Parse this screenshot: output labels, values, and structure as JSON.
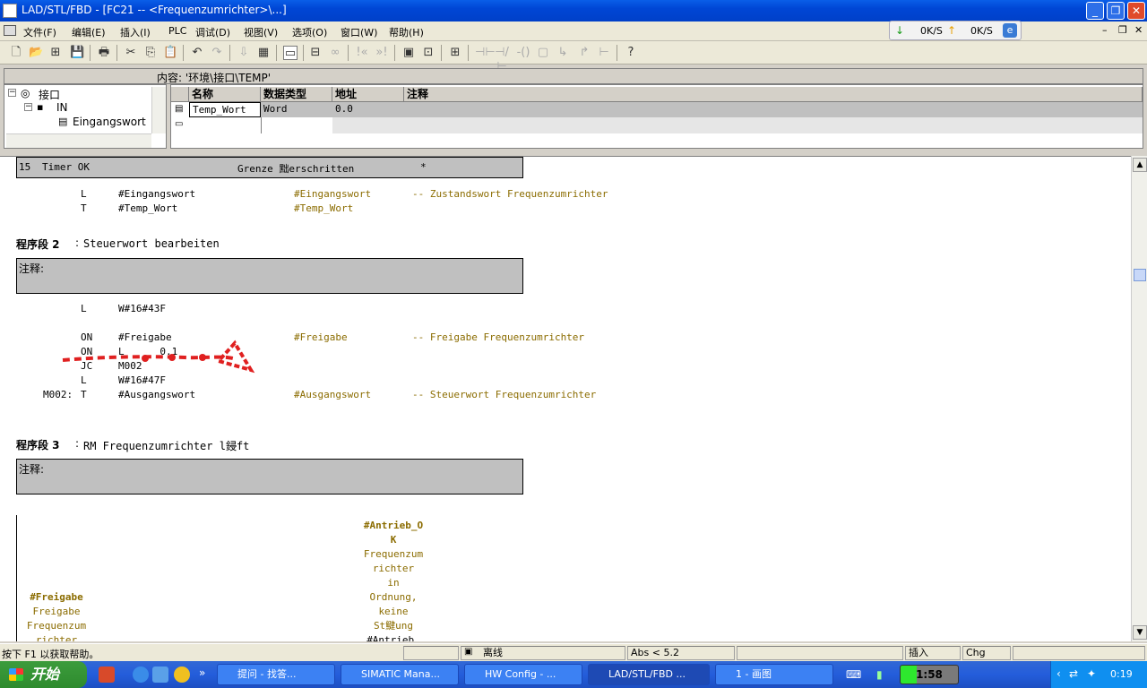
{
  "window": {
    "title": "LAD/STL/FBD - [FC21 -- <Frequenzumrichter>\\...]"
  },
  "menu": [
    "文件(F)",
    "编辑(E)",
    "插入(I)",
    "PLC",
    "调试(D)",
    "视图(V)",
    "选项(O)",
    "窗口(W)",
    "帮助(H)"
  ],
  "netspeed": {
    "down": "0K/S",
    "up": "0K/S"
  },
  "content_path": "内容: '环境\\接口\\TEMP'",
  "tree": {
    "root": "接口",
    "in": "IN",
    "child": "Eingangswort"
  },
  "vartable": {
    "headers": [
      "名称",
      "数据类型",
      "地址",
      "注释"
    ],
    "rows": [
      {
        "name": "Temp_Wort",
        "type": "Word",
        "addr": "0.0",
        "comment": ""
      }
    ]
  },
  "editor": {
    "top_box": {
      "num": "15",
      "label": "Timer OK",
      "mid": "Grenze 黜erschritten",
      "star": "*"
    },
    "seg1_lines": [
      {
        "op": "L",
        "arg": "#Eingangswort",
        "sym": "#Eingangswort",
        "cmt": "-- Zustandswort Frequenzumrichter"
      },
      {
        "op": "T",
        "arg": "#Temp_Wort",
        "sym": "#Temp_Wort",
        "cmt": ""
      }
    ],
    "seg2": {
      "title": "程序段 2",
      "desc": "Steuerwort bearbeiten",
      "comment_label": "注释:"
    },
    "seg2_lines": [
      {
        "label": "",
        "op": "L",
        "arg": "W#16#43F",
        "sym": "",
        "cmt": ""
      },
      {
        "label": "",
        "op": "ON",
        "arg": "#Freigabe",
        "sym": "#Freigabe",
        "cmt": "-- Freigabe Frequenzumrichter"
      },
      {
        "label": "",
        "op": "ON",
        "arg": "L      0.1",
        "sym": "",
        "cmt": ""
      },
      {
        "label": "",
        "op": "JC",
        "arg": "M002",
        "sym": "",
        "cmt": ""
      },
      {
        "label": "",
        "op": "L",
        "arg": "W#16#47F",
        "sym": "",
        "cmt": ""
      },
      {
        "label": "M002:",
        "op": "T",
        "arg": "#Ausgangswort",
        "sym": "#Ausgangswort",
        "cmt": "-- Steuerwort Frequenzumrichter"
      }
    ],
    "seg3": {
      "title": "程序段 3",
      "desc": "RM Frequenzumrichter l鋟ft",
      "comment_label": "注释:"
    },
    "fbd_left": {
      "sym": "#Freigabe",
      "lines": [
        "Freigabe",
        "Frequenzum",
        "richter"
      ]
    },
    "fbd_mid": {
      "sym1": "#Antrieb_O",
      "sym2": "K",
      "lines": [
        "Frequenzum",
        "richter",
        "in",
        "Ordnung,",
        "keine",
        "St鰎ung"
      ],
      "bottom": "#Antrieb_"
    }
  },
  "status": {
    "help": "按下 F1 以获取帮助。",
    "mode": "离线",
    "abs": "Abs < 5.2",
    "insert": "插入",
    "chg": "Chg"
  },
  "taskbar": {
    "start": "开始",
    "tasks": [
      "提问 - 找答...",
      "SIMATIC Mana...",
      "HW Config - ...",
      "LAD/STL/FBD  ...",
      "1 - 画图"
    ],
    "clock_box": "1:58",
    "time": "0:19"
  }
}
